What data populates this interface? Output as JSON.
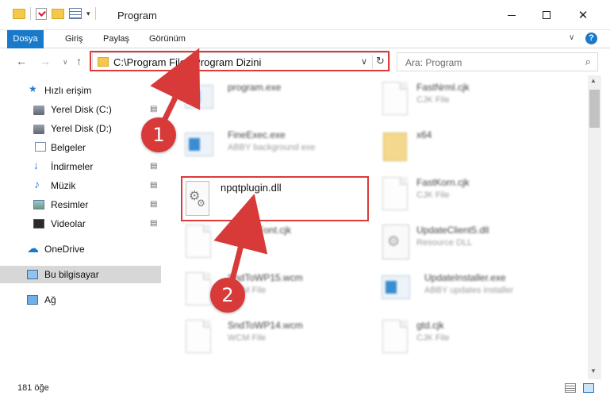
{
  "window": {
    "title": "Program",
    "minimize": "",
    "maximize": "",
    "close": "✕"
  },
  "ribbon": {
    "tabs": [
      "Dosya",
      "Giriş",
      "Paylaş",
      "Görünüm"
    ],
    "help": "?"
  },
  "nav": {
    "back": "←",
    "forward": "→",
    "recent": "∨",
    "up": "↑",
    "address": "C:\\Program Files\\Program Dizini",
    "address_dropdown": "∨",
    "refresh": "↻",
    "search_placeholder": "Ara: Program",
    "search_glyph": "⌕"
  },
  "sidebar": {
    "items": [
      {
        "label": "Hızlı erişim",
        "icon": "star-icon",
        "pinned": false
      },
      {
        "label": "Yerel Disk (C:)",
        "icon": "disk-icon",
        "pinned": true
      },
      {
        "label": "Yerel Disk (D:)",
        "icon": "disk-icon",
        "pinned": true
      },
      {
        "label": "Belgeler",
        "icon": "documents-icon",
        "pinned": true
      },
      {
        "label": "İndirmeler",
        "icon": "download-icon",
        "pinned": true
      },
      {
        "label": "Müzik",
        "icon": "music-icon",
        "pinned": true
      },
      {
        "label": "Resimler",
        "icon": "pictures-icon",
        "pinned": true
      },
      {
        "label": "Videolar",
        "icon": "videos-icon",
        "pinned": true
      },
      {
        "label": "OneDrive",
        "icon": "cloud-icon",
        "pinned": false
      },
      {
        "label": "Bu bilgisayar",
        "icon": "computer-icon",
        "pinned": false
      },
      {
        "label": "Ağ",
        "icon": "network-icon",
        "pinned": false
      }
    ],
    "pin_glyph": "📌"
  },
  "files": {
    "selected": {
      "name": "npqtplugin.dll"
    },
    "left": [
      {
        "name": "program.exe",
        "type": ""
      },
      {
        "name": "FineExec.exe",
        "type": "ABBY background exe"
      },
      {
        "name": "DefaultFont.cjk",
        "type": "CJK File"
      },
      {
        "name": "SndToWP15.wcm",
        "type": "WCM File"
      },
      {
        "name": "SndToWP14.wcm",
        "type": "WCM File"
      }
    ],
    "right": [
      {
        "name": "FastNrml.cjk",
        "type": "CJK File"
      },
      {
        "name": "x64",
        "type": ""
      },
      {
        "name": "FastKorn.cjk",
        "type": "CJK File"
      },
      {
        "name": "UpdateClient5.dll",
        "type": "Resource DLL"
      },
      {
        "name": "UpdateInstaller.exe",
        "type": "ABBY updates installer"
      },
      {
        "name": "gtd.cjk",
        "type": "CJK File"
      }
    ]
  },
  "annotations": {
    "step1": "1",
    "step2": "2",
    "color": "#d83a3a"
  },
  "status": {
    "count": "181 öğe"
  },
  "colors": {
    "accent": "#1979ca",
    "highlight": "#dd3a3a",
    "folder": "#f3c84b"
  }
}
